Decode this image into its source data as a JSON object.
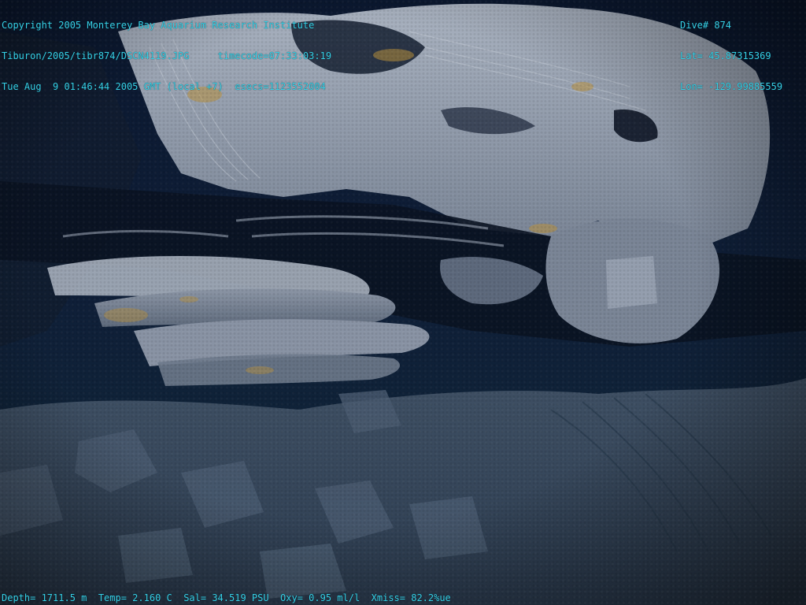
{
  "overlay": {
    "top_left": {
      "copyright": "Copyright 2005 Monterey Bay Aquarium Research Institute",
      "file_path": "Tiburon/2005/tibr874/DSCN4119.JPG",
      "timecode": "timecode=07:33:03:19",
      "datetime": "Tue Aug  9 01:46:44 2005 GMT (local +7)",
      "esecs": "esecs=1123552004"
    },
    "top_right": {
      "dive": "Dive# 874",
      "lat": "Lat= 45.87315369",
      "lon": "Lon= -129.99885559"
    },
    "bottom": {
      "depth": "Depth= 1711.5 m",
      "temp": "Temp= 2.160 C",
      "sal": "Sal= 34.519 PSU",
      "oxy": "Oxy= 0.95 ml/l",
      "xmiss": "Xmiss= 82.2%ue"
    }
  },
  "colors": {
    "overlay_text": "#36d0e6",
    "water": "#0c1a33",
    "rock_light": "#9fa8b6",
    "rock_mid": "#6c7688",
    "rock_dark": "#3d4a5c",
    "bacterial_mat": "#b8903c"
  }
}
